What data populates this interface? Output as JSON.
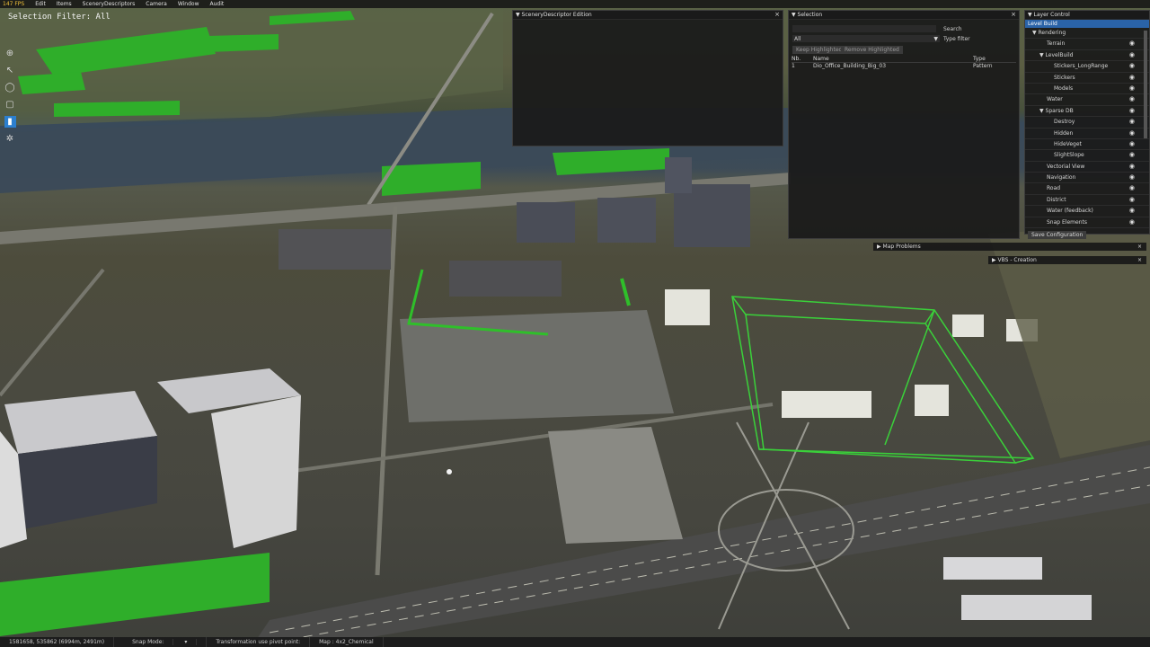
{
  "menu": {
    "fps": "147 FPS",
    "items": [
      "Edit",
      "Items",
      "SceneryDescriptors",
      "Camera",
      "Window",
      "Audit"
    ]
  },
  "selection_filter": "Selection Filter: All",
  "toolbar": {
    "tools": [
      {
        "icon": "crosshair-icon",
        "active": false
      },
      {
        "icon": "move-arrow-icon",
        "active": false
      },
      {
        "icon": "lasso-icon",
        "active": false
      },
      {
        "icon": "box-select-icon",
        "active": false
      },
      {
        "icon": "cursor-icon",
        "active": true
      },
      {
        "icon": "gizmo-icon",
        "active": false
      }
    ]
  },
  "scenery_panel": {
    "title": "▼ SceneryDescriptor Edition",
    "close": "×"
  },
  "selection_panel": {
    "title": "▼ Selection",
    "close": "×",
    "search_label": "Search",
    "filter_value": "All",
    "type_filter_label": "Type filter",
    "keep_btn": "Keep Highlighted",
    "remove_btn": "Remove Highlighted",
    "columns": [
      "Nb.",
      "Name",
      "Type"
    ],
    "rows": [
      {
        "nb": "1",
        "name": "Dio_Office_Building_Big_03",
        "type": "Pattern"
      }
    ]
  },
  "layer_control": {
    "title": "▼ Layer Control",
    "tab": "Level Build",
    "items": [
      {
        "label": "▼ Rendering",
        "indent": 0,
        "eye": false
      },
      {
        "label": "Terrain",
        "indent": 2,
        "eye": true
      },
      {
        "label": "▼ LevelBuild",
        "indent": 1,
        "eye": true
      },
      {
        "label": "Stickers_LongRange",
        "indent": 3,
        "eye": true
      },
      {
        "label": "Stickers",
        "indent": 3,
        "eye": true
      },
      {
        "label": "Models",
        "indent": 3,
        "eye": true
      },
      {
        "label": "Water",
        "indent": 2,
        "eye": true
      },
      {
        "label": "▼ Sparse DB",
        "indent": 1,
        "eye": true
      },
      {
        "label": "Destroy",
        "indent": 3,
        "eye": true
      },
      {
        "label": "Hidden",
        "indent": 3,
        "eye": true
      },
      {
        "label": "HideVeget",
        "indent": 3,
        "eye": true
      },
      {
        "label": "SlightSlope",
        "indent": 3,
        "eye": true
      },
      {
        "label": "Vectorial View",
        "indent": 2,
        "eye": true
      },
      {
        "label": "Navigation",
        "indent": 2,
        "eye": true
      },
      {
        "label": "Road",
        "indent": 2,
        "eye": true
      },
      {
        "label": "District",
        "indent": 2,
        "eye": true
      },
      {
        "label": "Water (feedback)",
        "indent": 2,
        "eye": true
      },
      {
        "label": "Snap Elements",
        "indent": 2,
        "eye": true
      }
    ],
    "save_btn": "Save Configuration"
  },
  "map_problems": {
    "title": "▶ Map Problems",
    "close": "×"
  },
  "vbs_creation": {
    "title": "▶ VBS - Creation",
    "close": "×"
  },
  "status": {
    "coords": "1581658, 535862 (6994m, 2491m)",
    "snap": "Snap Mode:",
    "snap_arrow": "▾",
    "transformation": "Transformation use pivot point:",
    "map": "Map : 4x2_Chemical"
  }
}
